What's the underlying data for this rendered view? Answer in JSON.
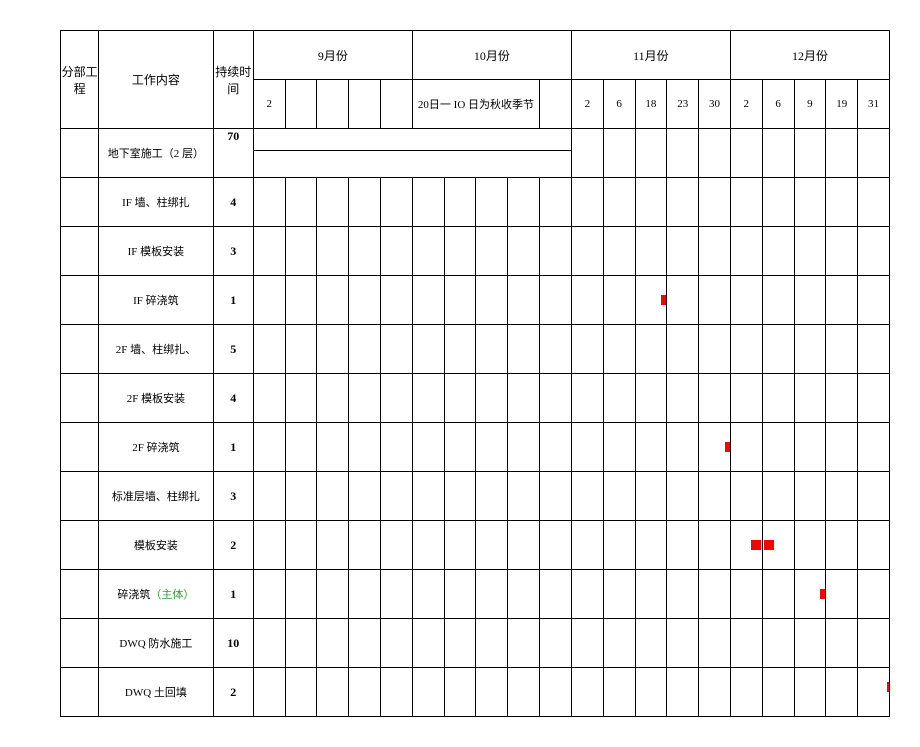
{
  "headers": {
    "sub_project": "分部工程",
    "work_content": "工作内容",
    "duration": "持续时间",
    "months": {
      "sep": "9月份",
      "oct": "10月份",
      "nov": "11月份",
      "dec": "12月份"
    },
    "sep_d1": "2",
    "oct_note": "20日一 IO 日为秋收季节",
    "nov_days": {
      "d1": "2",
      "d2": "6",
      "d3": "18",
      "d4": "23",
      "d5": "30"
    },
    "dec_days": {
      "d1": "2",
      "d2": "6",
      "d3": "9",
      "d4": "19",
      "d5": "31"
    }
  },
  "rows": [
    {
      "task": "地下室施工（2 层）",
      "duration": "70"
    },
    {
      "task": "IF 墙、柱绑扎",
      "duration": "4"
    },
    {
      "task": "IF 模板安装",
      "duration": "3"
    },
    {
      "task": "IF 碎浇筑",
      "duration": "1"
    },
    {
      "task": "2F 墙、柱绑扎、",
      "duration": "5"
    },
    {
      "task": "2F 模板安装",
      "duration": "4"
    },
    {
      "task": "2F 碎浇筑",
      "duration": "1"
    },
    {
      "task": "标准层墙、柱绑扎",
      "duration": "3"
    },
    {
      "task": "模板安装",
      "duration": "2"
    },
    {
      "task_prefix": "碎浇筑",
      "task_suffix": "（主体）",
      "duration": "1"
    },
    {
      "task": "DWQ 防水施工",
      "duration": "10"
    },
    {
      "task": "DWQ 土回填",
      "duration": "2"
    }
  ]
}
